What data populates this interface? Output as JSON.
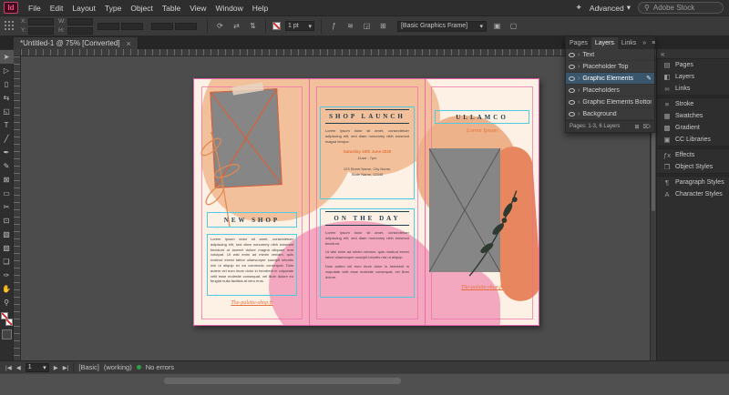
{
  "colors": {
    "ui_dark": "#2e2e2e",
    "canvas_gray": "#4c4c4c",
    "selection_blue_row": "#39566d",
    "blob_peach": "#f2c09a",
    "blob_salmon": "#e8875f",
    "blob_pink": "#f4a8bf",
    "guide_pink": "#ef6aa8",
    "guide_cyan": "#4fc9e4",
    "heading_navy": "#1e3c4c",
    "accent_orange": "#e5703b",
    "preflight_green": "#2f9e44",
    "logo_pink": "#ff4f7d"
  },
  "menu_bar": {
    "logo": "Id",
    "items": [
      "File",
      "Edit",
      "Layout",
      "Type",
      "Object",
      "Table",
      "View",
      "Window",
      "Help"
    ],
    "share_icon": "✦",
    "workspace": "Advanced",
    "caret": "▾",
    "search_icon": "⚲",
    "search_placeholder": "Adobe Stock"
  },
  "control_bar": {
    "x_label": "X:",
    "y_label": "Y:",
    "w_label": "W:",
    "h_label": "H:",
    "stroke_weight": "1 pt",
    "caret": "▾",
    "style_frame": "[Basic Graphics Frame]",
    "icons": {
      "flip_horizontal": "⇄",
      "flip_vertical": "⇅",
      "rotate": "⟳",
      "select_container": "▣",
      "select_content": "▢",
      "effects": "ƒ",
      "wrap": "≋",
      "corner_options": "◲",
      "frame_fitting": "⊞"
    }
  },
  "document_tab": {
    "title": "*Untitled-1 @ 75% [Converted]",
    "close_icon": "×"
  },
  "tools": [
    {
      "name": "Selection Tool",
      "glyph": "➤"
    },
    {
      "name": "Direct Selection Tool",
      "glyph": "▷"
    },
    {
      "name": "Page Tool",
      "glyph": "▯"
    },
    {
      "name": "Gap Tool",
      "glyph": "⇆"
    },
    {
      "name": "Content Collector Tool",
      "glyph": "◱"
    },
    {
      "name": "Type Tool",
      "glyph": "T"
    },
    {
      "name": "Line Tool",
      "glyph": "╱"
    },
    {
      "name": "Pen Tool",
      "glyph": "✒"
    },
    {
      "name": "Pencil Tool",
      "glyph": "✎"
    },
    {
      "name": "Rectangle Frame Tool",
      "glyph": "⊠"
    },
    {
      "name": "Rectangle Tool",
      "glyph": "▭"
    },
    {
      "name": "Scissors Tool",
      "glyph": "✂"
    },
    {
      "name": "Free Transform Tool",
      "glyph": "⊡"
    },
    {
      "name": "Gradient Swatch Tool",
      "glyph": "▧"
    },
    {
      "name": "Gradient Feather Tool",
      "glyph": "▨"
    },
    {
      "name": "Note Tool",
      "glyph": "❏"
    },
    {
      "name": "Eyedropper Tool",
      "glyph": "✑"
    },
    {
      "name": "Hand Tool",
      "glyph": "✋"
    },
    {
      "name": "Zoom Tool",
      "glyph": "⚲"
    }
  ],
  "layers_panel": {
    "tabs": [
      "Pages",
      "Layers",
      "Links"
    ],
    "panel_menu_icon": "≡",
    "collapse_icon": "»",
    "expand_chevron": "›",
    "pen_icon": "✎",
    "layers": [
      {
        "name": "Text"
      },
      {
        "name": "Placeholder Top"
      },
      {
        "name": "Graphic Elements"
      },
      {
        "name": "Placeholders"
      },
      {
        "name": "Graphic Elements Bottom"
      },
      {
        "name": "Background"
      }
    ],
    "status": "Pages: 1-3, 6 Layers",
    "new_layer_icon": "⊞",
    "delete_icon": "⌦"
  },
  "dock": {
    "expand_icon": "«",
    "groups": [
      {
        "items": [
          {
            "icon": "▤",
            "label": "Pages"
          },
          {
            "icon": "◧",
            "label": "Layers"
          },
          {
            "icon": "∞",
            "label": "Links"
          }
        ]
      },
      {
        "items": [
          {
            "icon": "≡",
            "label": "Stroke"
          },
          {
            "icon": "▦",
            "label": "Swatches"
          },
          {
            "icon": "▩",
            "label": "Gradient"
          },
          {
            "icon": "▣",
            "label": "CC Libraries"
          }
        ]
      },
      {
        "items": [
          {
            "icon": "ƒx",
            "label": "Effects"
          },
          {
            "icon": "❒",
            "label": "Object Styles"
          }
        ]
      },
      {
        "items": [
          {
            "icon": "¶",
            "label": "Paragraph Styles"
          },
          {
            "icon": "A",
            "label": "Character Styles"
          }
        ]
      }
    ]
  },
  "document": {
    "left_panel": {
      "heading": "NEW SHOP",
      "body": "Lorem ipsum dolor sit amet, consectetuer adipiscing elit, sed diam nonummy nibh euismod tincidunt ut laoreet dolore magna aliquam erat volutpat. Ut wisi enim ad minim veniam, quis nostrud exerci tation ullamcorper suscipit lobortis nisl ut aliquip ex ea commodo consequat. Duis autem vel eum iriure dolor in hendrerit in vulputate velit esse molestie consequat, vel illum dolore eu feugiat nulla facilisis at vero eros.",
      "website": "The-palette-shop.fr"
    },
    "middle_panel": {
      "heading_top": "SHOP LAUNCH",
      "intro": "Lorem ipsum dolor sit amet, consectetuer adipiscing elit, sed diam nonummy nibh euismod magna tempor.",
      "date": "Saturday 10th June 2020",
      "time": "11am - 7pm",
      "address_line1": "123 Street Name, City Name,",
      "address_line2": "State Name, 12345",
      "heading_bottom": "ON THE DAY",
      "body1": "Lorem ipsum dolor sit amet, consectetuer adipiscing elit, sed diam nonummy nibh euismod tincidunt.",
      "body2": "Ut wisi enim ad minim veniam, quis nostrud exerci tation ullamcorper suscipit lobortis nisl ut aliquip.",
      "body3": "Duis autem vel eum iriure dolor in hendrerit in vulputate velit esse molestie consequat, vel illum dolore."
    },
    "right_panel": {
      "heading": "ULLAMCO",
      "subheading_script": "Lorem Ipsum",
      "website": "The-palette-shop.fr"
    }
  },
  "status_bar": {
    "first_page_icon": "|◀",
    "prev_page_icon": "◀",
    "page_value": "1",
    "caret": "▾",
    "next_page_icon": "▶",
    "last_page_icon": "▶|",
    "preflight_profile": "[Basic]",
    "preflight_state": "(working)",
    "no_errors": "No errors"
  }
}
